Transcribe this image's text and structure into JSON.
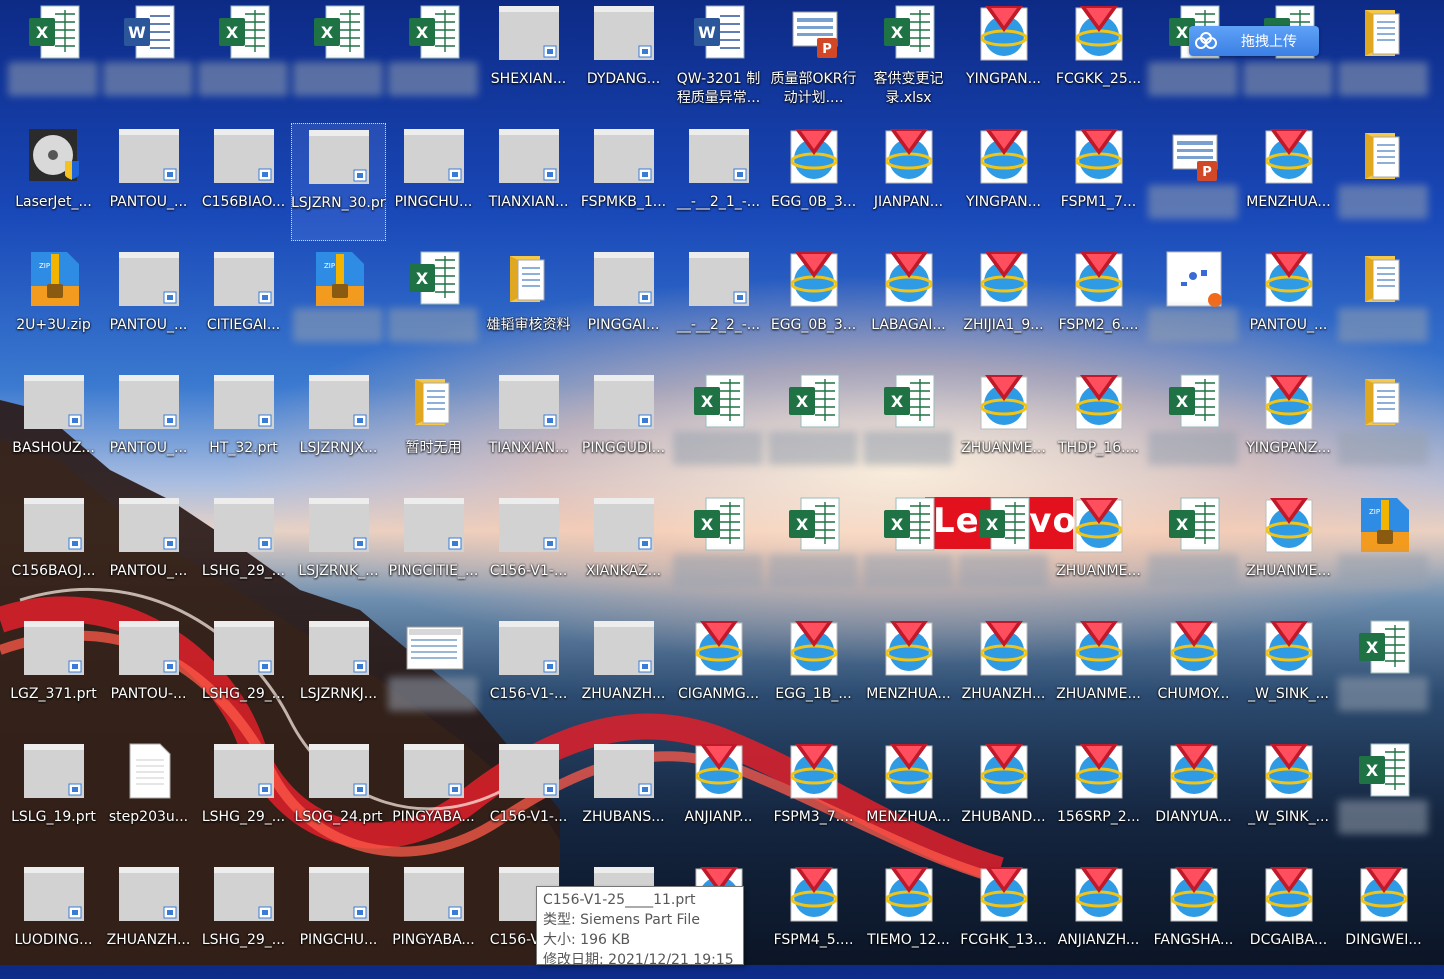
{
  "desktop": {
    "colors": {
      "excel": "#1f7244",
      "word": "#2b579a",
      "powerpoint": "#d24726",
      "zip": "#2e8ce4",
      "folder": "#f6c847",
      "nx": "#c0192a",
      "generic": "#d2d2d2"
    },
    "icons": [
      {
        "label": "",
        "type": "excel",
        "blurred": true
      },
      {
        "label": "",
        "type": "word",
        "blurred": true
      },
      {
        "label": "",
        "type": "excel",
        "blurred": true
      },
      {
        "label": "",
        "type": "excel",
        "blurred": true
      },
      {
        "label": "",
        "type": "excel",
        "blurred": true
      },
      {
        "label": "SHEXIAN...",
        "type": "prt"
      },
      {
        "label": "DYDANG...",
        "type": "prt"
      },
      {
        "label": "QW-3201 制程质量异常...",
        "type": "word",
        "two": true
      },
      {
        "label": "质量部OKR行动计划....",
        "type": "pptx",
        "two": true
      },
      {
        "label": "客供变更记录.xlsx",
        "type": "excel",
        "two": true
      },
      {
        "label": "YINGPAN...",
        "type": "nx"
      },
      {
        "label": "FCGKK_25...",
        "type": "nx"
      },
      {
        "label": "",
        "type": "excel",
        "blurred": true
      },
      {
        "label": "",
        "type": "excel",
        "blurred": true
      },
      {
        "label": "",
        "type": "folder-doc",
        "blurred": true
      },
      {
        "label": "LaserJet_...",
        "type": "setup"
      },
      {
        "label": "PANTOU_...",
        "type": "prt"
      },
      {
        "label": "C156BIAO...",
        "type": "prt"
      },
      {
        "label": "LSJZRN_30.prt",
        "type": "prt",
        "two": true,
        "selected": true
      },
      {
        "label": "PINGCHU...",
        "type": "prt"
      },
      {
        "label": "TIANXIAN...",
        "type": "prt"
      },
      {
        "label": "FSPMKB_1...",
        "type": "prt"
      },
      {
        "label": "__-__2_1_-...",
        "type": "prt"
      },
      {
        "label": "EGG_0B_3...",
        "type": "nx"
      },
      {
        "label": "JIANPAN...",
        "type": "nx"
      },
      {
        "label": "YINGPAN...",
        "type": "nx"
      },
      {
        "label": "FSPM1_7...",
        "type": "nx"
      },
      {
        "label": "",
        "type": "pptx",
        "blurred": true
      },
      {
        "label": "MENZHUA...",
        "type": "nx"
      },
      {
        "label": "",
        "type": "folder-doc",
        "blurred": true
      },
      {
        "label": "2U+3U.zip",
        "type": "zip"
      },
      {
        "label": "PANTOU_...",
        "type": "prt"
      },
      {
        "label": "CITIEGAI...",
        "type": "prt"
      },
      {
        "label": "",
        "type": "zip",
        "blurred": true
      },
      {
        "label": "",
        "type": "excel",
        "blurred": true
      },
      {
        "label": "雄韬审核资料",
        "type": "folder-doc"
      },
      {
        "label": "PINGGAI...",
        "type": "prt"
      },
      {
        "label": "__-__2_2_-...",
        "type": "prt"
      },
      {
        "label": "EGG_0B_3...",
        "type": "nx"
      },
      {
        "label": "LABAGAI...",
        "type": "nx"
      },
      {
        "label": "ZHIJIA1_9...",
        "type": "nx"
      },
      {
        "label": "FSPM2_6....",
        "type": "nx"
      },
      {
        "label": "",
        "type": "image",
        "blurred": true
      },
      {
        "label": "PANTOU_...",
        "type": "nx"
      },
      {
        "label": "",
        "type": "folder-doc",
        "blurred": true
      },
      {
        "label": "BASHOUZ...",
        "type": "prt"
      },
      {
        "label": "PANTOU_...",
        "type": "prt"
      },
      {
        "label": "HT_32.prt",
        "type": "prt"
      },
      {
        "label": "LSJZRNJX...",
        "type": "prt"
      },
      {
        "label": "暂时无用",
        "type": "folder-doc"
      },
      {
        "label": "TIANXIAN...",
        "type": "prt"
      },
      {
        "label": "PINGGUDI...",
        "type": "prt"
      },
      {
        "label": "",
        "type": "excel",
        "blurred": true
      },
      {
        "label": "",
        "type": "excel",
        "blurred": true
      },
      {
        "label": "",
        "type": "excel",
        "blurred": true
      },
      {
        "label": "ZHUANME...",
        "type": "nx"
      },
      {
        "label": "THDP_16....",
        "type": "nx"
      },
      {
        "label": "",
        "type": "excel",
        "blurred": true
      },
      {
        "label": "YINGPANZ...",
        "type": "nx"
      },
      {
        "label": "",
        "type": "folder-doc",
        "blurred": true
      },
      {
        "label": "C156BAOJ...",
        "type": "prt"
      },
      {
        "label": "PANTOU_...",
        "type": "prt"
      },
      {
        "label": "LSHG_29_...",
        "type": "prt"
      },
      {
        "label": "LSJZRNK_...",
        "type": "prt"
      },
      {
        "label": "PINGCITIE_...",
        "type": "prt"
      },
      {
        "label": "C156-V1-...",
        "type": "prt"
      },
      {
        "label": "XIANKAZ...",
        "type": "prt"
      },
      {
        "label": "",
        "type": "excel",
        "blurred": true
      },
      {
        "label": "",
        "type": "excel",
        "blurred": true
      },
      {
        "label": "",
        "type": "excel",
        "blurred": true
      },
      {
        "label": "",
        "type": "excel",
        "blurred": true
      },
      {
        "label": "ZHUANME...",
        "type": "nx"
      },
      {
        "label": "",
        "type": "excel",
        "blurred": true
      },
      {
        "label": "ZHUANME...",
        "type": "nx"
      },
      {
        "label": "",
        "type": "zip",
        "blurred": true
      },
      {
        "label": "LGZ_371.prt",
        "type": "prt"
      },
      {
        "label": "PANTOU-...",
        "type": "prt"
      },
      {
        "label": "LSHG_29_...",
        "type": "prt"
      },
      {
        "label": "LSJZRNKJ...",
        "type": "prt"
      },
      {
        "label": "",
        "type": "screenshot",
        "blurred": true
      },
      {
        "label": "C156-V1-...",
        "type": "prt"
      },
      {
        "label": "ZHUANZH...",
        "type": "prt"
      },
      {
        "label": "CIGANMG...",
        "type": "nx"
      },
      {
        "label": "EGG_1B_...",
        "type": "nx"
      },
      {
        "label": "MENZHUA...",
        "type": "nx"
      },
      {
        "label": "ZHUANZH...",
        "type": "nx"
      },
      {
        "label": "ZHUANME...",
        "type": "nx"
      },
      {
        "label": "CHUMOY...",
        "type": "nx"
      },
      {
        "label": "_W_SINK_...",
        "type": "nx"
      },
      {
        "label": "",
        "type": "excel",
        "blurred": true
      },
      {
        "label": "LSLG_19.prt",
        "type": "prt"
      },
      {
        "label": "step203u...",
        "type": "blank"
      },
      {
        "label": "LSHG_29_...",
        "type": "prt"
      },
      {
        "label": "LSQG_24.prt",
        "type": "prt"
      },
      {
        "label": "PINGYABA...",
        "type": "prt"
      },
      {
        "label": "C156-V1-...",
        "type": "prt"
      },
      {
        "label": "ZHUBANS...",
        "type": "prt"
      },
      {
        "label": "ANJIANP...",
        "type": "nx"
      },
      {
        "label": "FSPM3_7....",
        "type": "nx"
      },
      {
        "label": "MENZHUA...",
        "type": "nx"
      },
      {
        "label": "ZHUBAND...",
        "type": "nx"
      },
      {
        "label": "156SRP_2...",
        "type": "nx"
      },
      {
        "label": "DIANYUA...",
        "type": "nx"
      },
      {
        "label": "_W_SINK_...",
        "type": "nx"
      },
      {
        "label": "",
        "type": "excel",
        "blurred": true
      },
      {
        "label": "LUODING...",
        "type": "prt"
      },
      {
        "label": "ZHUANZH...",
        "type": "prt"
      },
      {
        "label": "LSHG_29_...",
        "type": "prt"
      },
      {
        "label": "PINGCHU...",
        "type": "prt"
      },
      {
        "label": "PINGYABA...",
        "type": "prt"
      },
      {
        "label": "C156-V1-...",
        "type": "prt",
        "hovered": true
      },
      {
        "label": "",
        "type": "prt"
      },
      {
        "label": "",
        "type": "nx"
      },
      {
        "label": "FSPM4_5....",
        "type": "nx"
      },
      {
        "label": "TIEMO_12...",
        "type": "nx"
      },
      {
        "label": "FCGHK_13...",
        "type": "nx"
      },
      {
        "label": "ANJIANZH...",
        "type": "nx"
      },
      {
        "label": "FANGSHA...",
        "type": "nx"
      },
      {
        "label": "DCGAIBA...",
        "type": "nx"
      },
      {
        "label": "DINGWEI...",
        "type": "nx"
      }
    ]
  },
  "upload_button": {
    "label": "拖拽上传"
  },
  "wallpaper_logo": {
    "text": "Lenovo"
  },
  "tooltip": {
    "name": "C156-V1-25____11.prt",
    "type_line": "类型: Siemens Part File",
    "size_line": "大小: 196 KB",
    "date_line": "修改日期: 2021/12/21 19:15"
  }
}
